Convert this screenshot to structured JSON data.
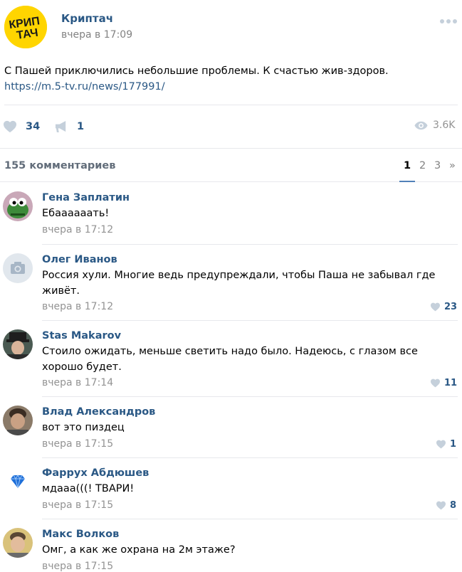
{
  "post": {
    "author": "Криптач",
    "logo_text": "КРИП ТАЧ",
    "date": "вчера в 17:09",
    "text": "С Пашей приключились небольшие проблемы. К счастью жив-здоров.",
    "link": "https://m.5-tv.ru/news/177991/",
    "likes": "34",
    "reposts": "1",
    "views": "3.6K"
  },
  "comments_header": {
    "count_label": "155 комментариев",
    "pages": [
      "1",
      "2",
      "3",
      "»"
    ],
    "active_page": "1"
  },
  "comments": [
    {
      "author": "Гена Заплатин",
      "text": "Ебаааааать!",
      "date": "вчера в 17:12",
      "likes": ""
    },
    {
      "author": "Олег Иванов",
      "text": "Россия хули. Многие ведь предупреждали, чтобы Паша не забывал где живёт.",
      "date": "вчера в 17:12",
      "likes": "23"
    },
    {
      "author": "Stas Makarov",
      "text": "Стоило ожидать, меньше светить надо было. Надеюсь, с глазом все хорошо будет.",
      "date": "вчера в 17:14",
      "likes": "11"
    },
    {
      "author": "Влад Александров",
      "text": "вот это пиздец",
      "date": "вчера в 17:15",
      "likes": "1"
    },
    {
      "author": "Фаррух Абдюшев",
      "text": "мдааа(((! ТВАРИ!",
      "date": "вчера в 17:15",
      "likes": "8"
    },
    {
      "author": "Макс Волков",
      "text": "Омг, а как же охрана на 2м этаже?",
      "date": "вчера в 17:15",
      "likes": ""
    }
  ],
  "colors": {
    "link": "#2a5885",
    "accent": "#5181b8",
    "secondary_text": "#939393",
    "logo_bg": "#ffd500"
  }
}
